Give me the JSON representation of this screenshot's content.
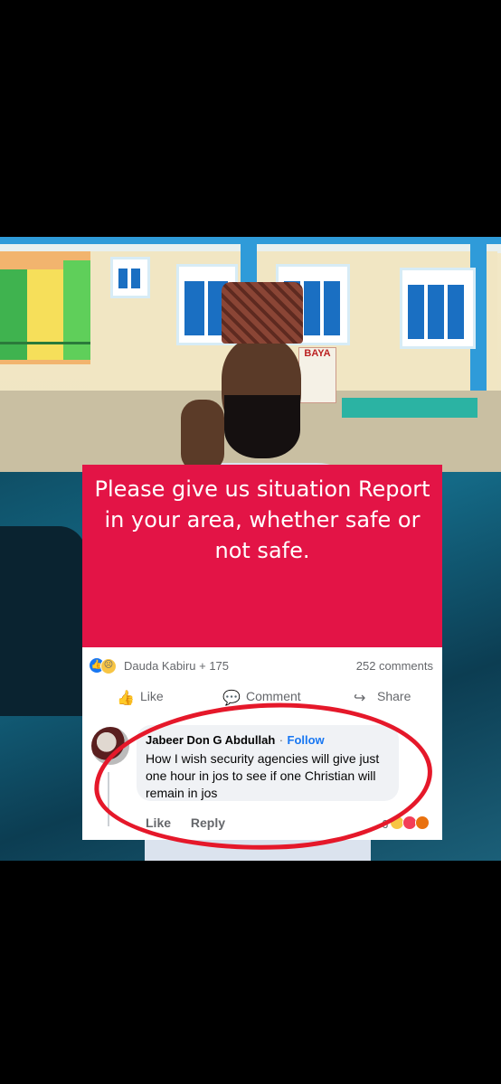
{
  "banner": {
    "text": "Please give us situation Report in your area, whether safe or not safe."
  },
  "signs": {
    "shop_sign": "BAYA"
  },
  "post": {
    "reactors": "Dauda Kabiru + 175",
    "comments_count": "252 comments",
    "actions": {
      "like": "Like",
      "comment": "Comment",
      "share": "Share"
    }
  },
  "comment": {
    "author": "Jabeer Don G Abdullah",
    "separator": "·",
    "follow": "Follow",
    "text": "How I wish security agencies will give just one hour in jos to see if one Christian will remain in jos",
    "like": "Like",
    "reply": "Reply",
    "reaction_count": "6"
  },
  "colors": {
    "banner": "#e31446",
    "link": "#1877f2",
    "annotation_ring": "#e5182a"
  }
}
